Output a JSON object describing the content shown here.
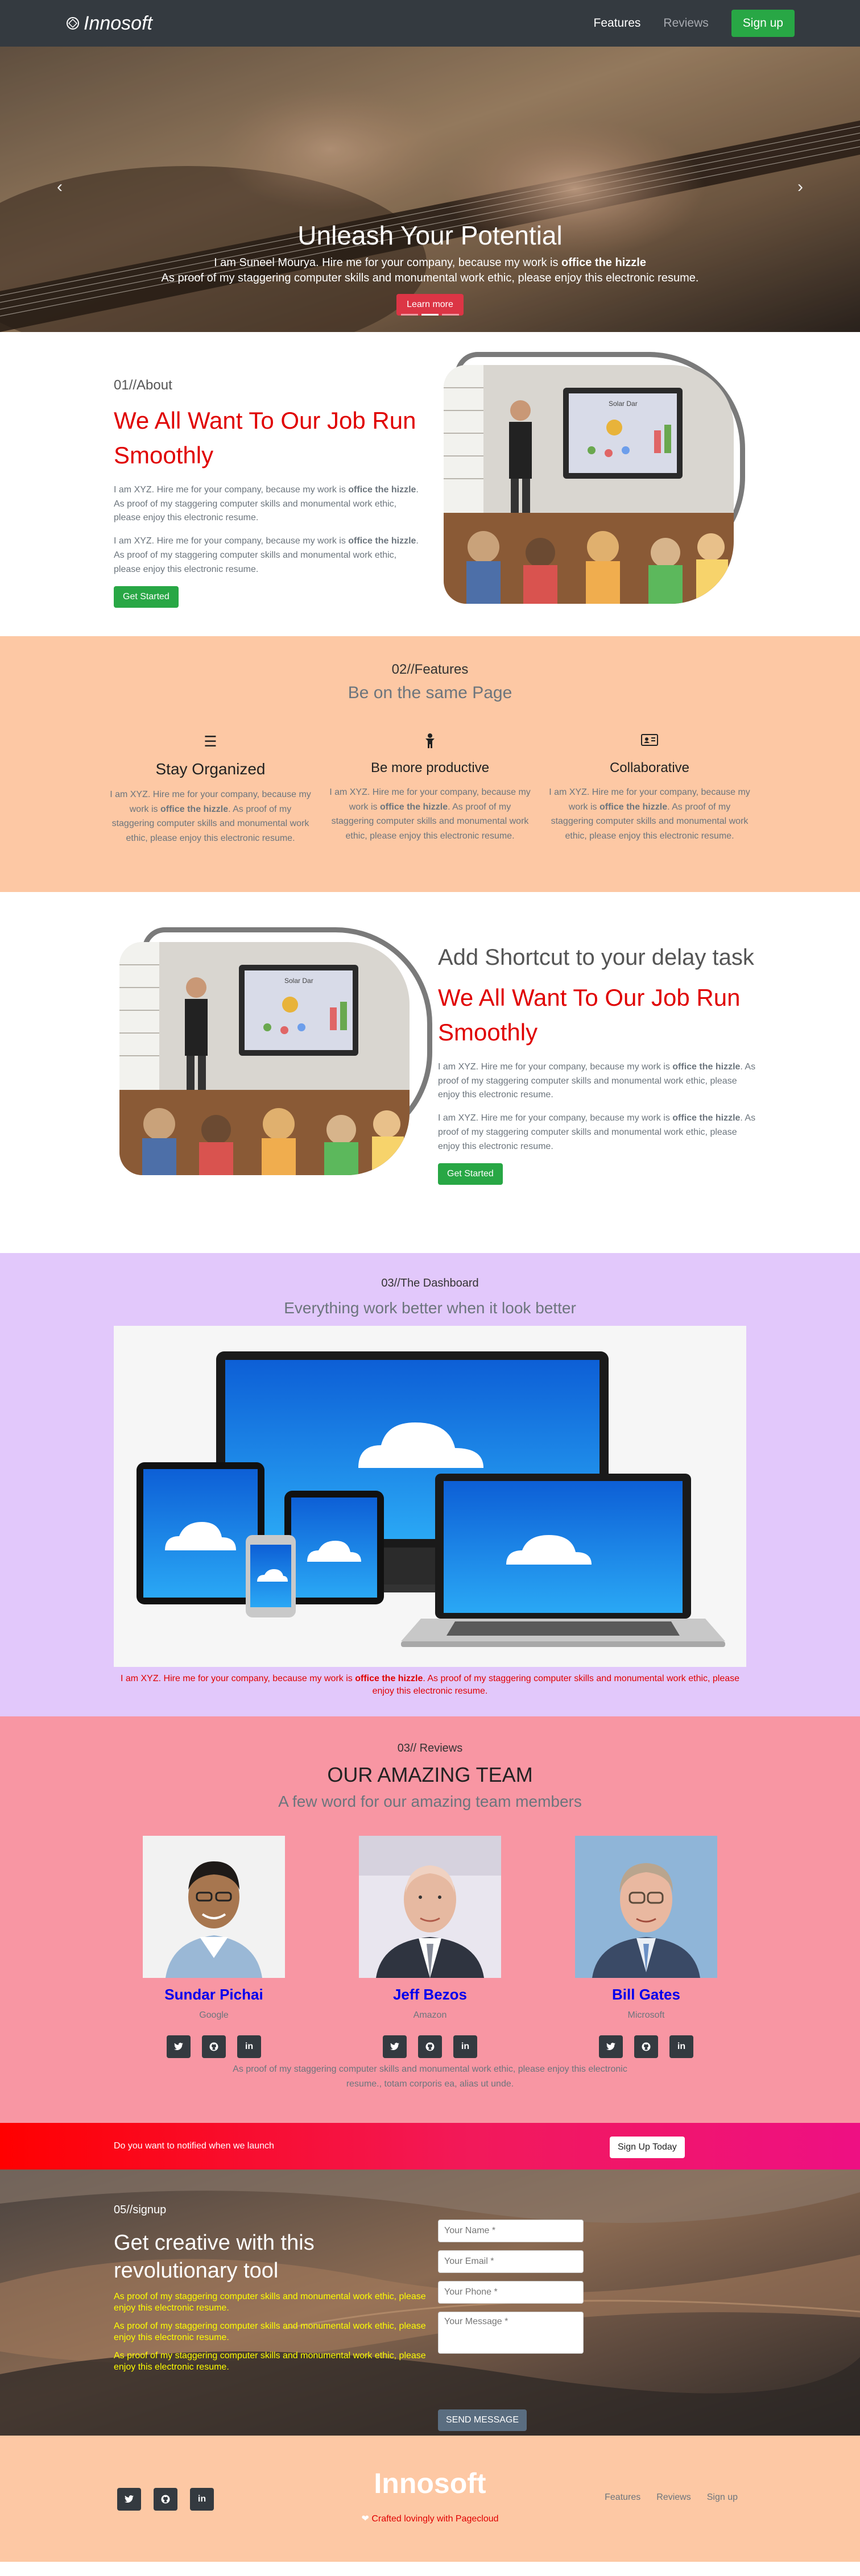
{
  "nav": {
    "brand": "Innosoft",
    "links": [
      "Features",
      "Reviews"
    ],
    "signup": "Sign up"
  },
  "hero": {
    "title": "Unleash Your Potential",
    "line1_pre": "I am Suneel Mourya. Hire me for your company, because my work is ",
    "line1_bold": "office the hizzle",
    "line2": "As proof of my staggering computer skills and monumental work ethic, please enjoy this electronic resume.",
    "button": "Learn more",
    "prev": "‹",
    "next": "›"
  },
  "about": {
    "tag": "01//About",
    "title": "We All Want To Our Job Run Smoothly",
    "para_pre": "I am XYZ. Hire me for your company, because my work is ",
    "para_bold": "office the hizzle",
    "para_post": ". As proof of my staggering computer skills and monumental work ethic, please enjoy this electronic resume.",
    "button": "Get Started",
    "board_label": "Solar Dar"
  },
  "features": {
    "tag": "02//Features",
    "subtitle": "Be on the same Page",
    "items": [
      {
        "title": "Stay Organized",
        "icon": "menu-icon",
        "glyph": "☰"
      },
      {
        "title": "Be more productive",
        "icon": "child-icon",
        "glyph": "🯅"
      },
      {
        "title": "Collaborative",
        "icon": "id-card-icon",
        "glyph": "🪪"
      }
    ],
    "text_pre": "I am XYZ. Hire me for your company, because my work is ",
    "text_bold": "office the hizzle",
    "text_post": ". As proof of my staggering computer skills and monumental work ethic, please enjoy this electronic resume."
  },
  "shortcut": {
    "title": "Add Shortcut to your delay task",
    "red_title": "We All Want To Our Job Run Smoothly",
    "para_pre": "I am XYZ. Hire me for your company, because my work is ",
    "para_bold": "office the hizzle",
    "para_post": ". As proof of my staggering computer skills and monumental work ethic, please enjoy this electronic resume.",
    "button": "Get Started"
  },
  "dashboard": {
    "tag": "03//The Dashboard",
    "subtitle": "Everything work better when it look better",
    "caption_pre": "I am XYZ. Hire me for your company, because my work is ",
    "caption_bold": "office the hizzle",
    "caption_post": ". As proof of my staggering computer skills and monumental work ethic, please enjoy this electronic resume."
  },
  "reviews": {
    "tag": "03// Reviews",
    "heading": "OUR AMAZING TEAM",
    "subtitle": "A few word for our amazing team members",
    "members": [
      {
        "name": "Sundar Pichai",
        "company": "Google"
      },
      {
        "name": "Jeff Bezos",
        "company": "Amazon"
      },
      {
        "name": "Bill Gates",
        "company": "Microsoft"
      }
    ],
    "note": "As proof of my staggering computer skills and monumental work ethic, please enjoy this electronic resume., totam corporis ea, alias ut unde."
  },
  "notify": {
    "text": "Do you want to notified when we launch",
    "button": "Sign Up Today"
  },
  "signup": {
    "tag": "05//signup",
    "title": "Get creative with this revolutionary tool",
    "yellow": "As proof of my staggering computer skills and monumental work ethic, please enjoy this electronic resume.",
    "placeholders": {
      "name": "Your Name *",
      "email": "Your Email *",
      "phone": "Your Phone *",
      "message": "Your Message *"
    },
    "button": "SEND MESSAGE"
  },
  "footer": {
    "brand": "Innosoft",
    "crafted": "Crafted lovingly with Pagecloud",
    "links": [
      "Features",
      "Reviews",
      "Sign up"
    ]
  },
  "social": {
    "twitter": "t",
    "github": "●",
    "linkedin": "in"
  },
  "colors": {
    "accent_red": "#e00000",
    "green": "#28a745",
    "peach": "#fdc8a4",
    "lavender": "#e2c8fb",
    "pink": "#f896a3",
    "dark": "#343a40"
  }
}
